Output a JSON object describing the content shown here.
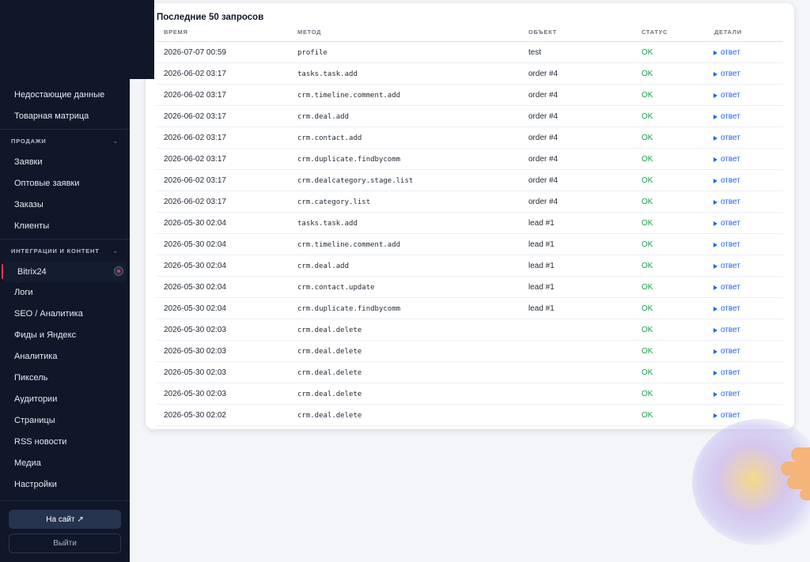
{
  "sidebar": {
    "items_top": [
      {
        "label": "Недостающие данные"
      },
      {
        "label": "Товарная матрица"
      }
    ],
    "section_sales": "ПРОДАЖИ",
    "items_sales": [
      {
        "label": "Заявки"
      },
      {
        "label": "Оптовые заявки"
      },
      {
        "label": "Заказы"
      },
      {
        "label": "Клиенты"
      }
    ],
    "section_integrations": "ИНТЕГРАЦИИ И КОНТЕНТ",
    "items_integrations": [
      {
        "label": "Bitrix24"
      },
      {
        "label": "Логи"
      },
      {
        "label": "SEO / Аналитика"
      },
      {
        "label": "Фиды и Яндекс"
      },
      {
        "label": "Аналитика"
      },
      {
        "label": "Пиксель"
      },
      {
        "label": "Аудитории"
      },
      {
        "label": "Страницы"
      },
      {
        "label": "RSS новости"
      },
      {
        "label": "Медиа"
      },
      {
        "label": "Настройки"
      }
    ],
    "site_button": "На сайт ↗",
    "logout_button": "Выйти"
  },
  "main": {
    "title": "Последние 50 запросов",
    "columns": [
      "ВРЕМЯ",
      "МЕТОД",
      "ОБЪЕКТ",
      "СТАТУС",
      "ДЕТАЛИ"
    ],
    "rows": [
      {
        "time": "2026-07-07 00:59",
        "method": "profile",
        "object": "test",
        "status": "OK",
        "details": "ответ"
      },
      {
        "time": "2026-06-02 03:17",
        "method": "tasks.task.add",
        "object": "order #4",
        "status": "OK",
        "details": "ответ"
      },
      {
        "time": "2026-06-02 03:17",
        "method": "crm.timeline.comment.add",
        "object": "order #4",
        "status": "OK",
        "details": "ответ"
      },
      {
        "time": "2026-06-02 03:17",
        "method": "crm.deal.add",
        "object": "order #4",
        "status": "OK",
        "details": "ответ"
      },
      {
        "time": "2026-06-02 03:17",
        "method": "crm.contact.add",
        "object": "order #4",
        "status": "OK",
        "details": "ответ"
      },
      {
        "time": "2026-06-02 03:17",
        "method": "crm.duplicate.findbycomm",
        "object": "order #4",
        "status": "OK",
        "details": "ответ"
      },
      {
        "time": "2026-06-02 03:17",
        "method": "crm.dealcategory.stage.list",
        "object": "order #4",
        "status": "OK",
        "details": "ответ"
      },
      {
        "time": "2026-06-02 03:17",
        "method": "crm.category.list",
        "object": "order #4",
        "status": "OK",
        "details": "ответ"
      },
      {
        "time": "2026-05-30 02:04",
        "method": "tasks.task.add",
        "object": "lead #1",
        "status": "OK",
        "details": "ответ"
      },
      {
        "time": "2026-05-30 02:04",
        "method": "crm.timeline.comment.add",
        "object": "lead #1",
        "status": "OK",
        "details": "ответ"
      },
      {
        "time": "2026-05-30 02:04",
        "method": "crm.deal.add",
        "object": "lead #1",
        "status": "OK",
        "details": "ответ"
      },
      {
        "time": "2026-05-30 02:04",
        "method": "crm.contact.update",
        "object": "lead #1",
        "status": "OK",
        "details": "ответ"
      },
      {
        "time": "2026-05-30 02:04",
        "method": "crm.duplicate.findbycomm",
        "object": "lead #1",
        "status": "OK",
        "details": "ответ"
      },
      {
        "time": "2026-05-30 02:03",
        "method": "crm.deal.delete",
        "object": "",
        "status": "OK",
        "details": "ответ"
      },
      {
        "time": "2026-05-30 02:03",
        "method": "crm.deal.delete",
        "object": "",
        "status": "OK",
        "details": "ответ"
      },
      {
        "time": "2026-05-30 02:03",
        "method": "crm.deal.delete",
        "object": "",
        "status": "OK",
        "details": "ответ"
      },
      {
        "time": "2026-05-30 02:03",
        "method": "crm.deal.delete",
        "object": "",
        "status": "OK",
        "details": "ответ"
      },
      {
        "time": "2026-05-30 02:02",
        "method": "crm.deal.delete",
        "object": "",
        "status": "OK",
        "details": "ответ"
      }
    ]
  },
  "icons": {
    "section_chevron": "chevron-down-icon",
    "details_arrow": "play-triangle-icon",
    "active_indicator": "record-dot-icon"
  },
  "colors": {
    "sidebar_bg": "#0f1729",
    "status_ok": "#16a34a",
    "link": "#2563eb",
    "active_accent": "#e5384f"
  }
}
